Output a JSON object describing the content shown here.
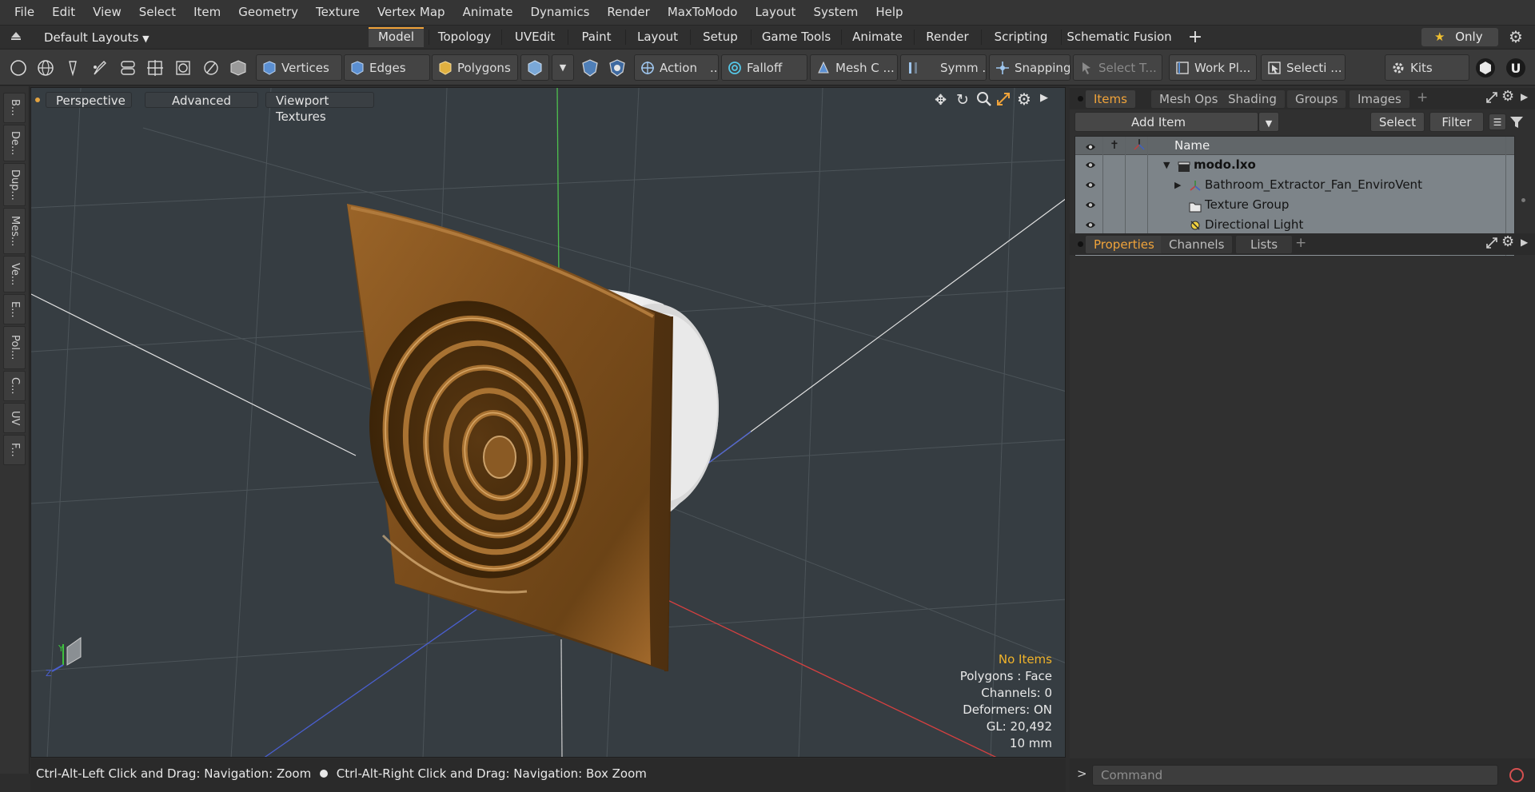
{
  "menubar": {
    "items": [
      "File",
      "Edit",
      "View",
      "Select",
      "Item",
      "Geometry",
      "Texture",
      "Vertex Map",
      "Animate",
      "Dynamics",
      "Render",
      "MaxToModo",
      "Layout",
      "System",
      "Help"
    ]
  },
  "layoutbar": {
    "layout_select": "Default Layouts",
    "tabs": [
      "Model",
      "Topology",
      "UVEdit",
      "Paint",
      "Layout",
      "Setup",
      "Game Tools",
      "Animate",
      "Render",
      "Scripting",
      "Schematic Fusion"
    ],
    "active_tab": "Model",
    "add": "+",
    "only": "Only"
  },
  "toolbar": {
    "vertices": "Vertices",
    "edges": "Edges",
    "polygons": "Polygons",
    "action": "Action",
    "action_more": "...",
    "falloff": "Falloff",
    "mesh": "Mesh C ...",
    "symm": "Symm ...",
    "snapping": "Snapping",
    "select_t": "Select T...",
    "work_plane": "Work Pl...",
    "selection": "Selecti ...",
    "kits": "Kits"
  },
  "leftstrip": {
    "tabs": [
      "B...",
      "De...",
      "Dup...",
      "Mes...",
      "Ve...",
      "E...",
      "Pol...",
      "C...",
      "UV",
      "F..."
    ]
  },
  "viewport": {
    "perspective": "Perspective",
    "advanced": "Advanced",
    "viewport_textures": "Viewport Textures",
    "info": {
      "selection": "No Items",
      "polygons": "Polygons : Face",
      "channels": "Channels: 0",
      "deformers": "Deformers: ON",
      "gl": "GL: 20,492",
      "scale": "10 mm"
    }
  },
  "statusbar": {
    "hint1": "Ctrl-Alt-Left Click and Drag: Navigation: Zoom",
    "hint2": "Ctrl-Alt-Right Click and Drag: Navigation: Box Zoom"
  },
  "items_panel": {
    "tabs": [
      "Items",
      "Mesh Ops",
      "Shading",
      "Groups",
      "Images"
    ],
    "active_tab": "Items",
    "add_item": "Add Item",
    "select": "Select",
    "filter": "Filter",
    "column_name": "Name",
    "rows": [
      {
        "label": "modo.lxo",
        "bold": true
      },
      {
        "label": "Bathroom_Extractor_Fan_EnviroVent"
      },
      {
        "label": "Texture Group"
      },
      {
        "label": "Directional Light"
      }
    ]
  },
  "properties_panel": {
    "tabs": [
      "Properties",
      "Channels",
      "Lists"
    ],
    "active_tab": "Properties",
    "add": "+"
  },
  "command": {
    "placeholder": "Command"
  },
  "colors": {
    "accent": "#f0a33a",
    "viewport_bg": "#363d42",
    "fan_body": "#8b5a22",
    "info_yellow": "#f0b32a"
  }
}
